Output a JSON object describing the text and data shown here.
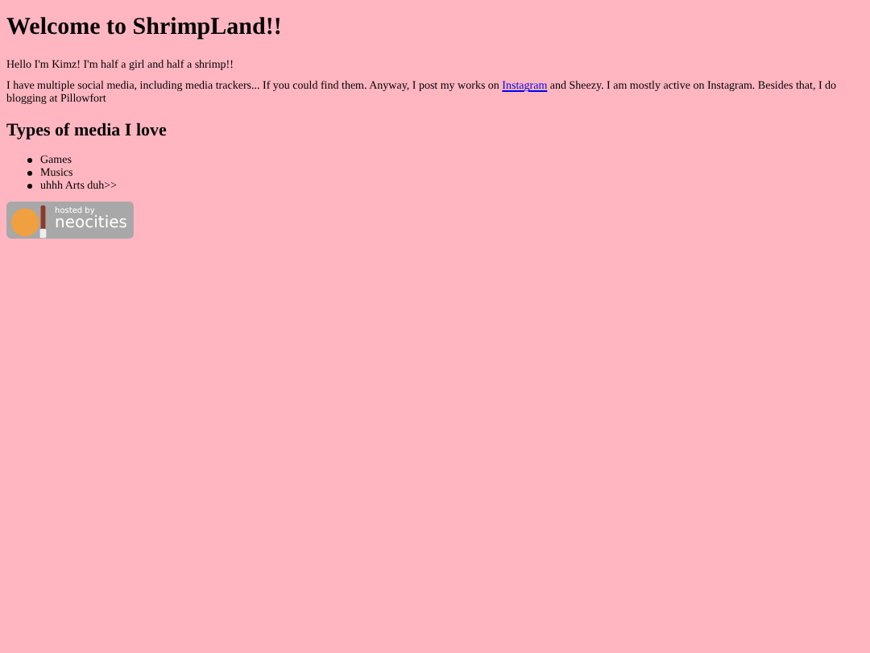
{
  "title": "Welcome to ShrimpLand!!",
  "intro": "Hello I'm Kimz! I'm half a girl and half a shrimp!!",
  "paragraph": {
    "before": "I have multiple social media, including media trackers... If you could find them. Anyway, I post my works on",
    "link": "Instagram",
    "after": "and Sheezy. I am mostly active on Instagram. Besides that, I do blogging at Pillowfort"
  },
  "section_heading": "Types of media I love",
  "media_list": [
    "Games",
    "Musics",
    "uhhh Arts duh>>"
  ],
  "badge": {
    "line_1": "hosted by",
    "line_2": "neocities"
  }
}
